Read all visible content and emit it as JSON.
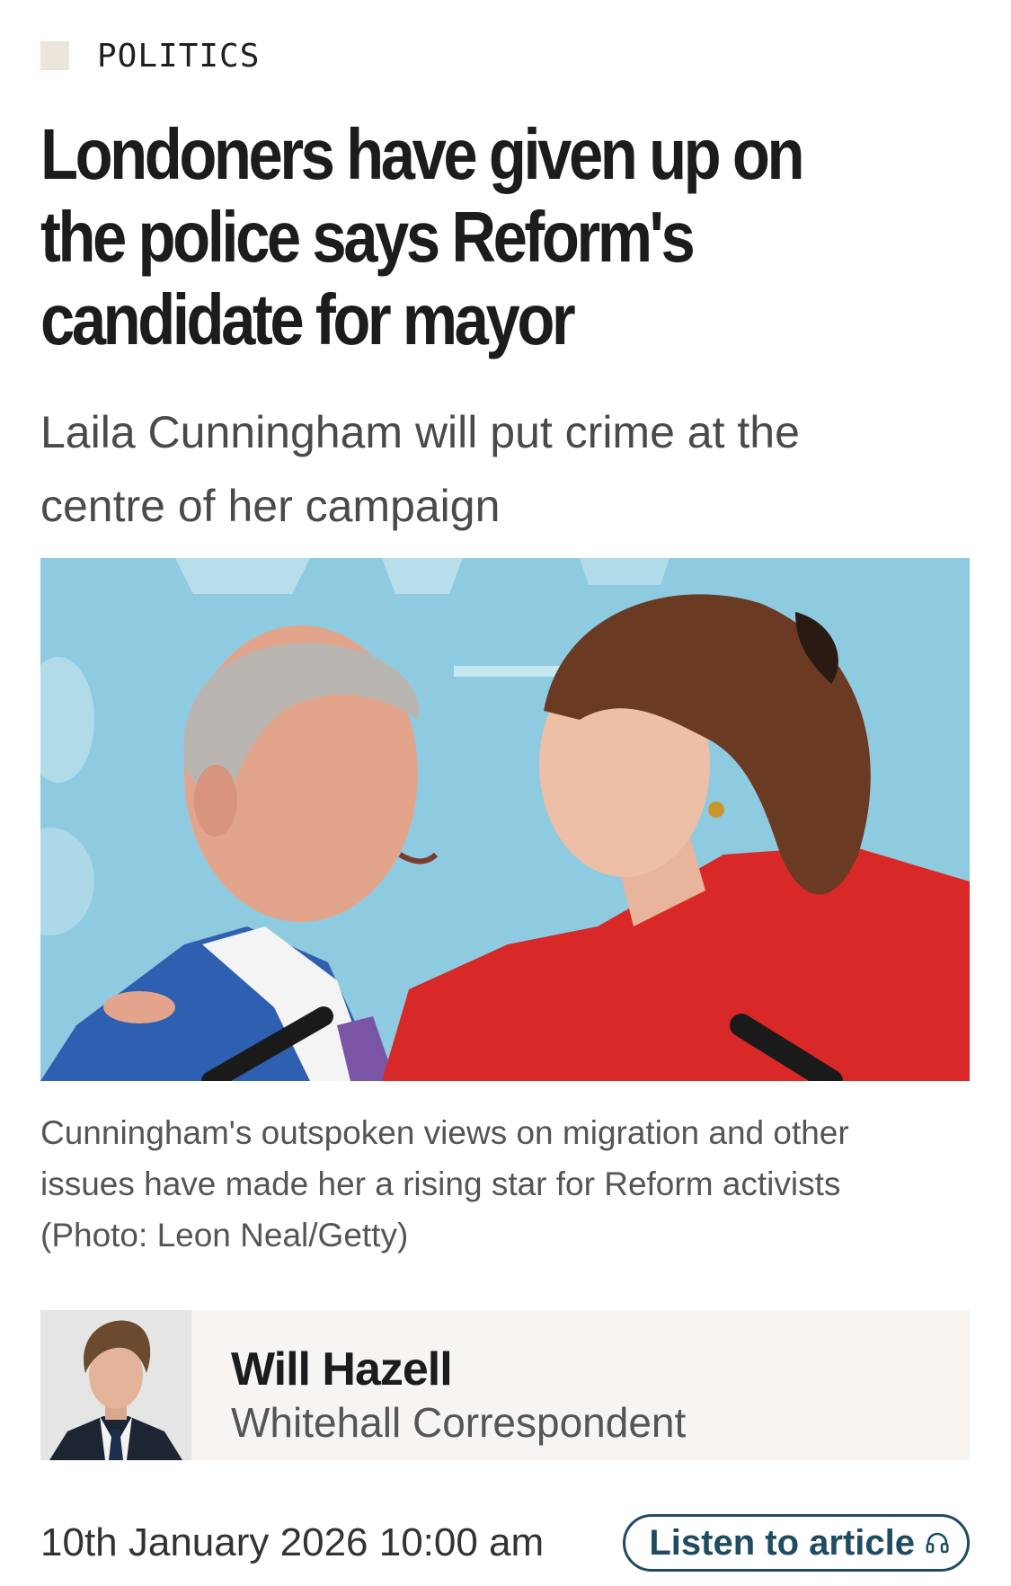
{
  "section": {
    "label": "POLITICS",
    "square_color": "#ebe5dc"
  },
  "article": {
    "headline": "Londoners have given up on the police says Reform's candidate for mayor",
    "standfirst": "Laila Cunningham will put crime at the centre of her campaign",
    "image_caption": "Cunningham's outspoken views on migration and other issues have made her a rising star for Reform activists (Photo: Leon Neal/Getty)"
  },
  "author": {
    "name": "Will Hazell",
    "role": "Whitehall Correspondent",
    "card_bg": "#f7f4f1"
  },
  "meta": {
    "date": "10th January 2026 10:00 am",
    "listen_label": "Listen to article",
    "listen_icon": "headphones-icon",
    "accent": "#1f4c63"
  }
}
